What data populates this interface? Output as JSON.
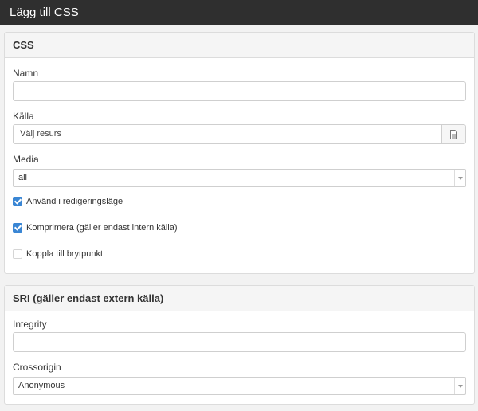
{
  "window": {
    "title": "Lägg till CSS"
  },
  "css_panel": {
    "heading": "CSS",
    "name_label": "Namn",
    "name_value": "",
    "source_label": "Källa",
    "source_value": "Välj resurs",
    "source_icon": "document-icon",
    "media_label": "Media",
    "media_value": "all",
    "checkboxes": [
      {
        "label": "Använd i redigeringsläge",
        "checked": true
      },
      {
        "label": "Komprimera (gäller endast intern källa)",
        "checked": true
      },
      {
        "label": "Koppla till brytpunkt",
        "checked": false
      }
    ]
  },
  "sri_panel": {
    "heading": "SRI (gäller endast extern källa)",
    "integrity_label": "Integrity",
    "integrity_value": "",
    "crossorigin_label": "Crossorigin",
    "crossorigin_value": "Anonymous"
  },
  "colors": {
    "titlebar": "#2f2f2f",
    "checkbox_checked": "#3a86d4",
    "background": "#f2f2f2"
  }
}
